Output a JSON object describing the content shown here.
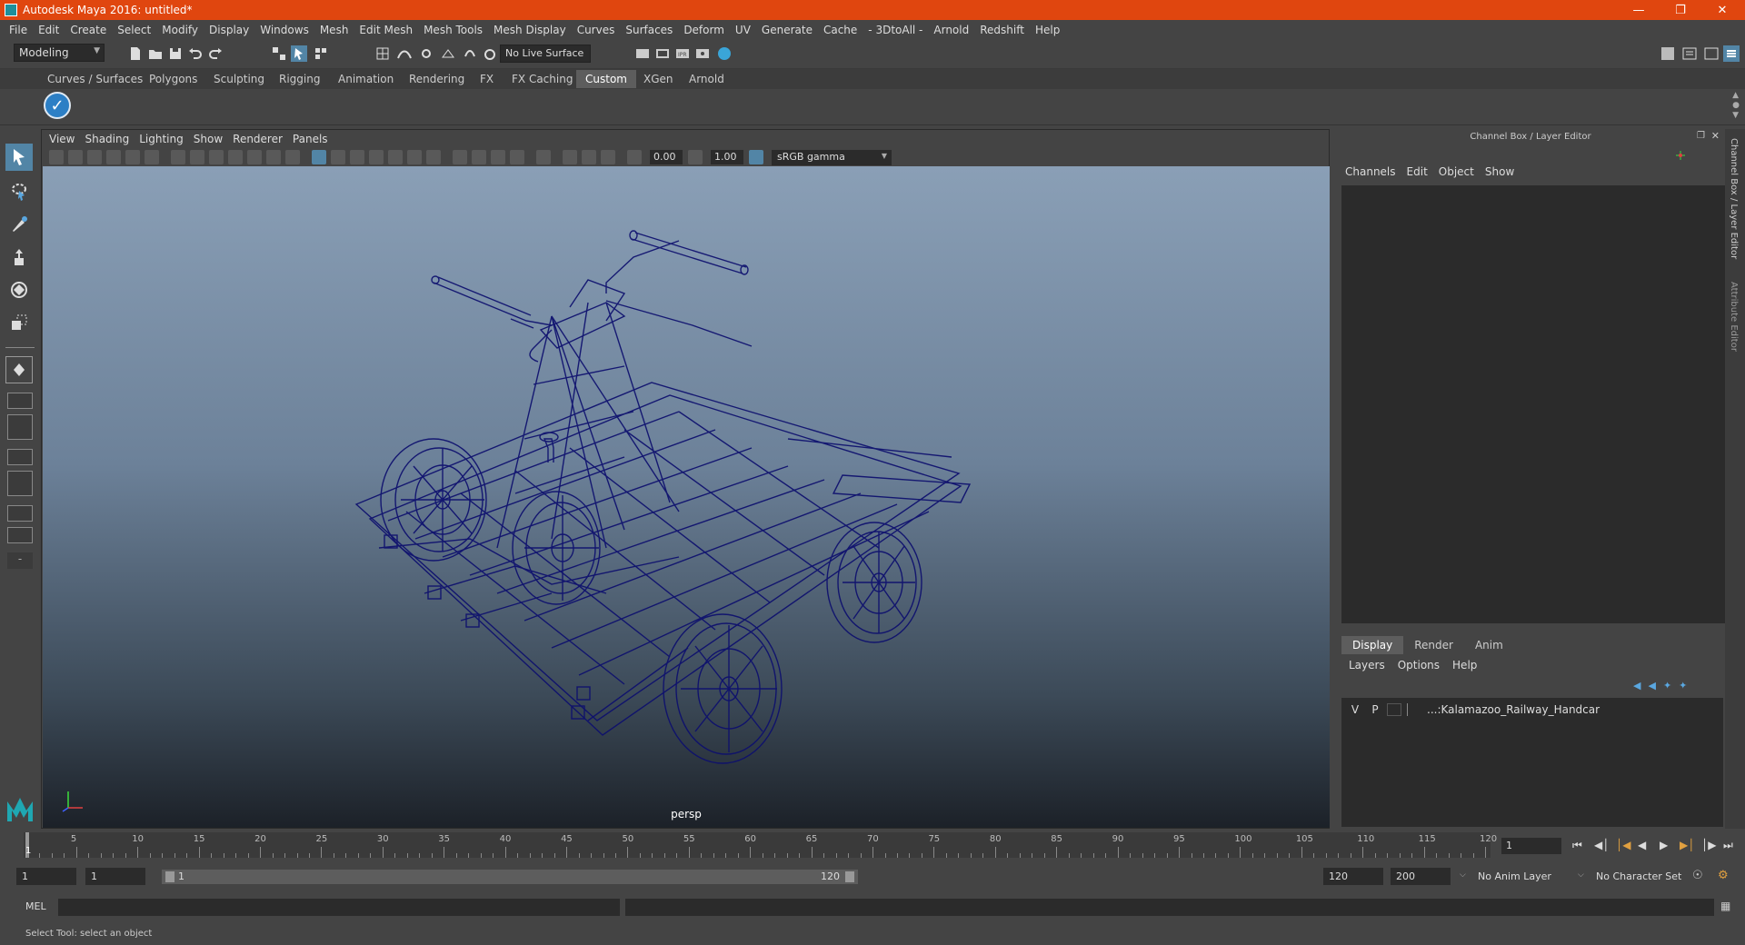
{
  "window": {
    "title": "Autodesk Maya 2016: untitled*"
  },
  "menubar": [
    "File",
    "Edit",
    "Create",
    "Select",
    "Modify",
    "Display",
    "Windows",
    "Mesh",
    "Edit Mesh",
    "Mesh Tools",
    "Mesh Display",
    "Curves",
    "Surfaces",
    "Deform",
    "UV",
    "Generate",
    "Cache",
    "- 3DtoAll -",
    "Arnold",
    "Redshift",
    "Help"
  ],
  "statusline": {
    "mode": "Modeling",
    "live_surface": "No Live Surface"
  },
  "shelf": {
    "tabs": [
      "Curves / Surfaces",
      "Polygons",
      "Sculpting",
      "Rigging",
      "Animation",
      "Rendering",
      "FX",
      "FX Caching",
      "Custom",
      "XGen",
      "Arnold"
    ],
    "active_tab": "Custom"
  },
  "viewport": {
    "menu": [
      "View",
      "Shading",
      "Lighting",
      "Show",
      "Renderer",
      "Panels"
    ],
    "exposure": "0.00",
    "gamma": "1.00",
    "color_space": "sRGB gamma",
    "camera": "persp",
    "wire_color": "#0d0f6e"
  },
  "channel_box": {
    "title": "Channel Box / Layer Editor",
    "menu": [
      "Channels",
      "Edit",
      "Object",
      "Show"
    ],
    "layer_tabs": [
      "Display",
      "Render",
      "Anim"
    ],
    "active_layer_tab": "Display",
    "layer_menu": [
      "Layers",
      "Options",
      "Help"
    ],
    "layers": [
      {
        "v": "V",
        "p": "P",
        "name": "...:Kalamazoo_Railway_Handcar"
      }
    ],
    "side_tabs": [
      "Channel Box / Layer Editor",
      "Attribute Editor"
    ]
  },
  "timeslider": {
    "ticks": [
      "5",
      "10",
      "15",
      "20",
      "25",
      "30",
      "35",
      "40",
      "45",
      "50",
      "55",
      "60",
      "65",
      "70",
      "75",
      "80",
      "85",
      "90",
      "95",
      "100",
      "105",
      "110",
      "115",
      "120"
    ],
    "current": "1",
    "current_frame_field": "1"
  },
  "rangeslider": {
    "start": "1",
    "playback_start": "1",
    "bar_left": "1",
    "bar_right": "120",
    "playback_end": "120",
    "end": "200",
    "anim_layer": "No Anim Layer",
    "character_set": "No Character Set"
  },
  "cmdline": {
    "label": "MEL"
  },
  "helpline": {
    "text": "Select Tool: select an object"
  }
}
